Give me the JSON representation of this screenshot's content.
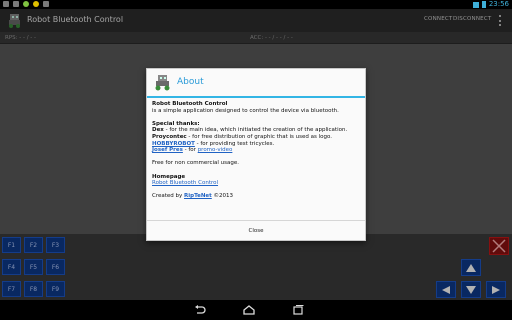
{
  "status_bar": {
    "time": "23:56",
    "icons": [
      "notification-icon",
      "usb-icon",
      "android-icon",
      "bulb-icon",
      "download-icon",
      "wifi-icon",
      "battery-icon"
    ]
  },
  "action_bar": {
    "title": "Robot Bluetooth Control",
    "connect_label": "CONNECT",
    "disconnect_label": "DISCONNECT",
    "overflow_icon": "overflow-menu-icon"
  },
  "value_bar": {
    "left_label": "RPS: - - / - -",
    "right_label": "ACC: - - / - - / - -"
  },
  "dialog": {
    "title": "About",
    "app_name": "Robot Bluetooth Control",
    "description": "is a simple application designed to control the device via bluetooth.",
    "thanks_heading": "Special thanks:",
    "thanks": [
      {
        "name": "Dex",
        "text": " - for the main idea, which initiated the creation of the application."
      },
      {
        "name": "Proycontec",
        "text": " - for free distribution of graphic that is used as logo."
      },
      {
        "name": "HOBBYROBOT",
        "text": " - for providing test tricycles."
      },
      {
        "name": "Josef Pres",
        "text": " - for ",
        "link": "promo-video"
      }
    ],
    "license": "Free for non commercial usage.",
    "homepage_heading": "Homepage",
    "homepage_link": "Robot Bluetooth Control",
    "created_by": "Created by ",
    "author": "RipTeNet",
    "year": " ©2013",
    "close_label": "Close"
  },
  "function_buttons": [
    "F1",
    "F2",
    "F3",
    "F4",
    "F5",
    "F6",
    "F7",
    "F8",
    "F9"
  ],
  "direction_buttons": [
    "up",
    "left",
    "down",
    "right"
  ],
  "colors": {
    "accent": "#33b5e5",
    "function_button": "#0e3a8c",
    "stop_button": "#8c1010"
  },
  "nav_bar": {
    "icons": [
      "back-icon",
      "home-icon",
      "recent-apps-icon"
    ]
  }
}
